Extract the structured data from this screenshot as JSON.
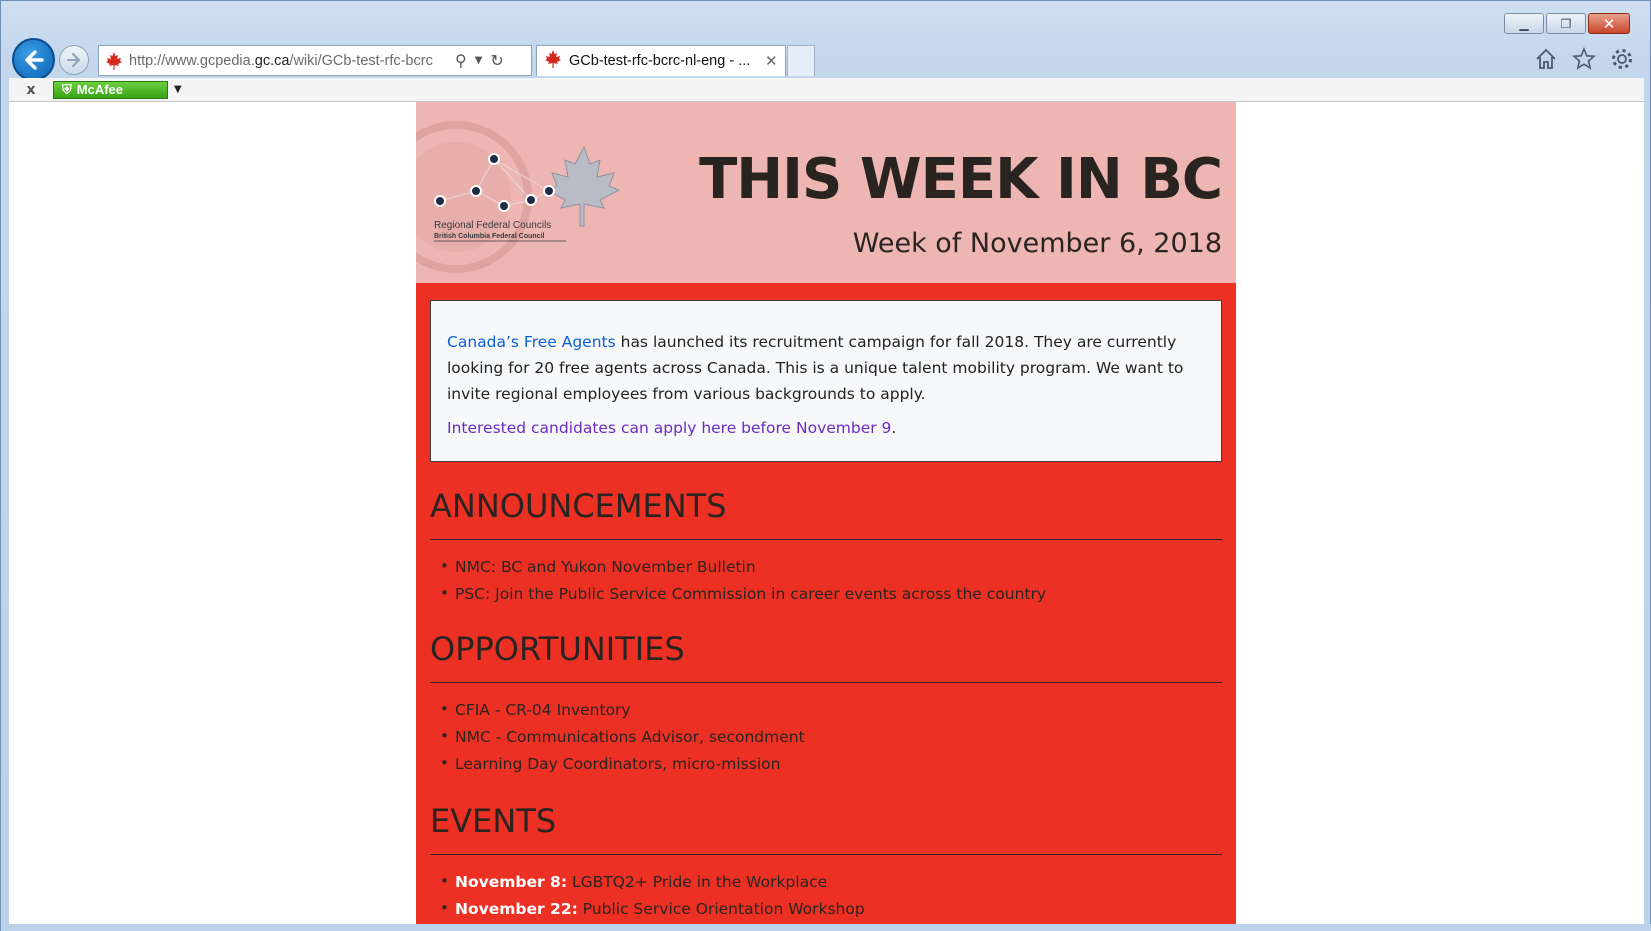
{
  "browser": {
    "url_prefix": "http://www.gcpedia.",
    "url_domain": "gc.ca",
    "url_path": "/wiki/GCb-test-rfc-bcrc",
    "tab_title": "GCb-test-rfc-bcrc-nl-eng - ...",
    "toolbar_close": "x",
    "mcafee_label": "McAfee"
  },
  "banner": {
    "headline": "THIS WEEK IN BC",
    "week": "Week of November 6, 2018",
    "logo_line1": "Regional Federal Councils",
    "logo_line2": "British Columbia Federal Council"
  },
  "callout": {
    "link_text": "Canada’s Free Agents",
    "body": " has launched its recruitment campaign for fall 2018. They are currently looking for 20 free agents across Canada. This is a unique talent mobility program. We want to invite regional employees from various backgrounds to apply.",
    "apply_link": "Interested candidates can apply here before November 9",
    "apply_period": "."
  },
  "announcements": {
    "heading": "ANNOUNCEMENTS",
    "items": [
      "NMC: BC and Yukon November Bulletin",
      "PSC: Join the Public Service Commission in career events across the country"
    ]
  },
  "opportunities": {
    "heading": "OPPORTUNITIES",
    "items": [
      "CFIA - CR-04 Inventory",
      "NMC - Communications Advisor, secondment",
      "Learning Day Coordinators, micro-mission"
    ]
  },
  "events": {
    "heading": "EVENTS",
    "items": [
      {
        "date": "November 8:",
        "title": "LGBTQ2+ Pride in the Workplace"
      },
      {
        "date": "November 22:",
        "title": "Public Service Orientation Workshop"
      }
    ]
  },
  "colors": {
    "page_red": "#ec3023",
    "banner_pink": "#edb6b2",
    "link_blue": "#0b5ed7",
    "visited_purple": "#6a2dc0"
  }
}
